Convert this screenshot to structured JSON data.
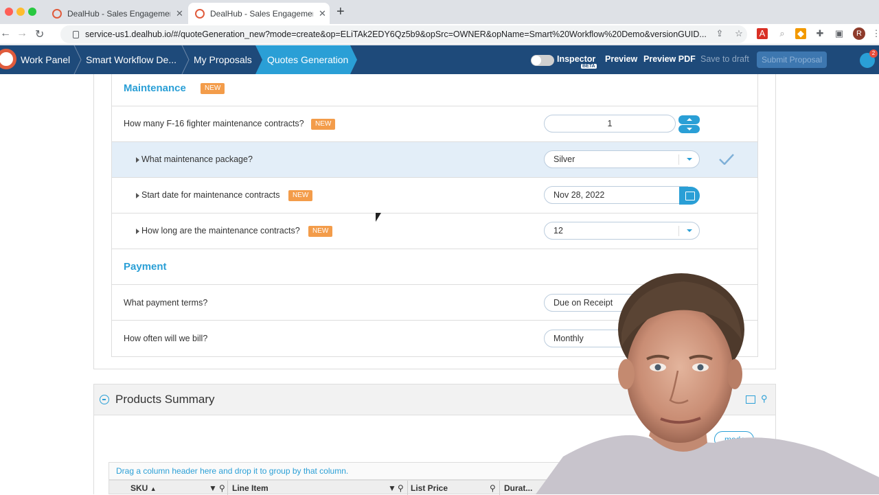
{
  "browser": {
    "tabs": [
      {
        "title": "DealHub - Sales Engagement P",
        "active": false
      },
      {
        "title": "DealHub - Sales Engagement P",
        "active": true
      }
    ],
    "new_tab": "+",
    "url": "service-us1.dealhub.io/#/quoteGeneration_new?mode=create&op=ELiTAk2EDY6Qz5b9&opSrc=OWNER&opName=Smart%20Workflow%20Demo&versionGUID...",
    "profile_initial": "R"
  },
  "app": {
    "breadcrumbs": [
      "Work Panel",
      "Smart Workflow De...",
      "My Proposals",
      "Quotes Generation"
    ],
    "inspector_label": "Inspector",
    "beta_label": "BETA",
    "preview_label": "Preview",
    "preview_pdf_label": "Preview PDF",
    "save_draft_label": "Save to draft",
    "submit_label": "Submit Proposal",
    "notification_count": "2"
  },
  "maintenance": {
    "title": "Maintenance",
    "title_badge": "NEW",
    "questions": [
      {
        "text": "How many F-16 fighter maintenance contracts?",
        "badge": "NEW",
        "value": "1"
      },
      {
        "text": "What maintenance package?",
        "badge": "",
        "value": "Silver"
      },
      {
        "text": "Start date for maintenance contracts",
        "badge": "NEW",
        "value": "Nov 28, 2022"
      },
      {
        "text": "How long are the maintenance contracts?",
        "badge": "NEW",
        "value": "12"
      }
    ]
  },
  "payment": {
    "title": "Payment",
    "questions": [
      {
        "text": "What payment terms?",
        "value": "Due on Receipt"
      },
      {
        "text": "How often will we bill?",
        "value": "Monthly"
      }
    ]
  },
  "products_summary": {
    "title": "Products Summary",
    "mode_button": "mode",
    "group_hint": "Drag a column header here and drop it to group by that column.",
    "columns": [
      "SKU",
      "Line Item",
      "List Price",
      "Durat..."
    ]
  },
  "colors": {
    "accent": "#2a9fd6",
    "header": "#1e4a7a",
    "badge": "#f39c4a"
  }
}
